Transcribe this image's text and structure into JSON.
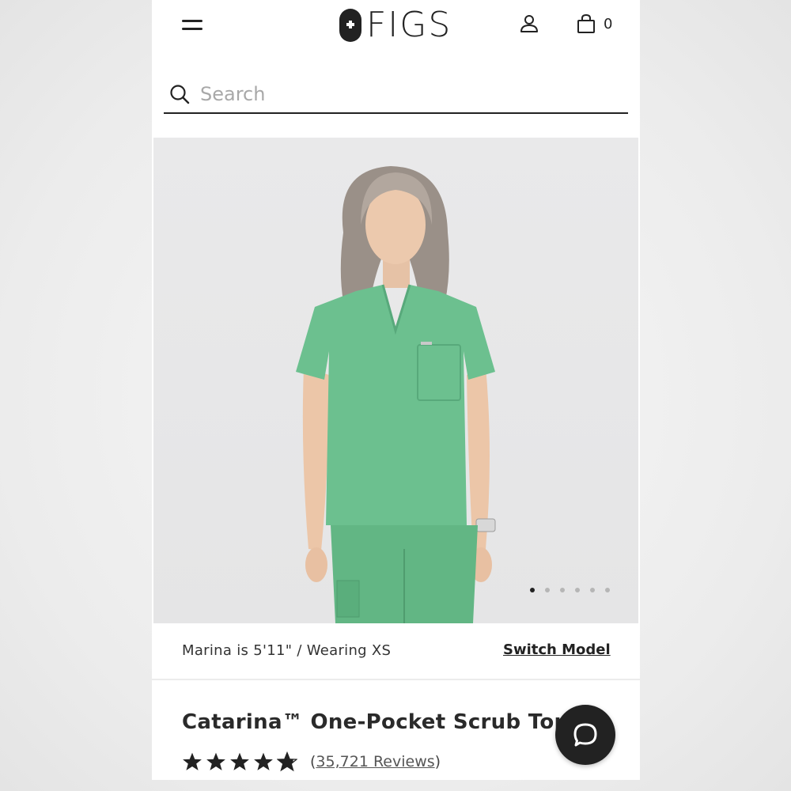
{
  "header": {
    "logo_text": "FIGS",
    "cart_count": "0"
  },
  "search": {
    "placeholder": "Search"
  },
  "gallery": {
    "total_images": 6,
    "active_index": 0
  },
  "model_info": {
    "text": "Marina is 5'11\" / Wearing XS",
    "switch_label": "Switch Model"
  },
  "product": {
    "title": "Catarina™ One-Pocket Scrub Top",
    "rating": 4.8,
    "reviews_open": "(",
    "reviews_label": "35,721 Reviews",
    "reviews_close": ")"
  },
  "colors": {
    "scrub": "#6cc08f",
    "accent": "#222222",
    "background": "#e6e6e7"
  },
  "icons": {
    "menu": "hamburger-icon",
    "account": "user-icon",
    "cart": "shopping-bag-icon",
    "search": "search-icon",
    "chat": "chat-bubble-icon"
  }
}
